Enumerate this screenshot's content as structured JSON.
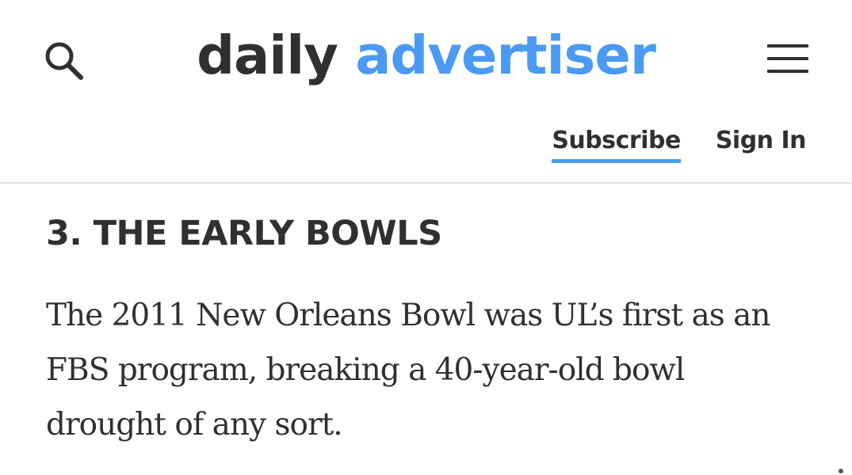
{
  "header": {
    "search_icon": "search-icon",
    "brand_part1": "daily",
    "brand_part2": "advertiser",
    "menu_icon": "hamburger-menu-icon",
    "subscribe_label": "Subscribe",
    "signin_label": "Sign In",
    "colors": {
      "brand_dark": "#303030",
      "brand_accent": "#4a9af1"
    }
  },
  "article": {
    "heading": "3. THE EARLY BOWLS",
    "paragraph": "The 2011 New Orleans Bowl was UL’s first as an FBS program, breaking a 40-year-old bowl drought of any sort."
  }
}
